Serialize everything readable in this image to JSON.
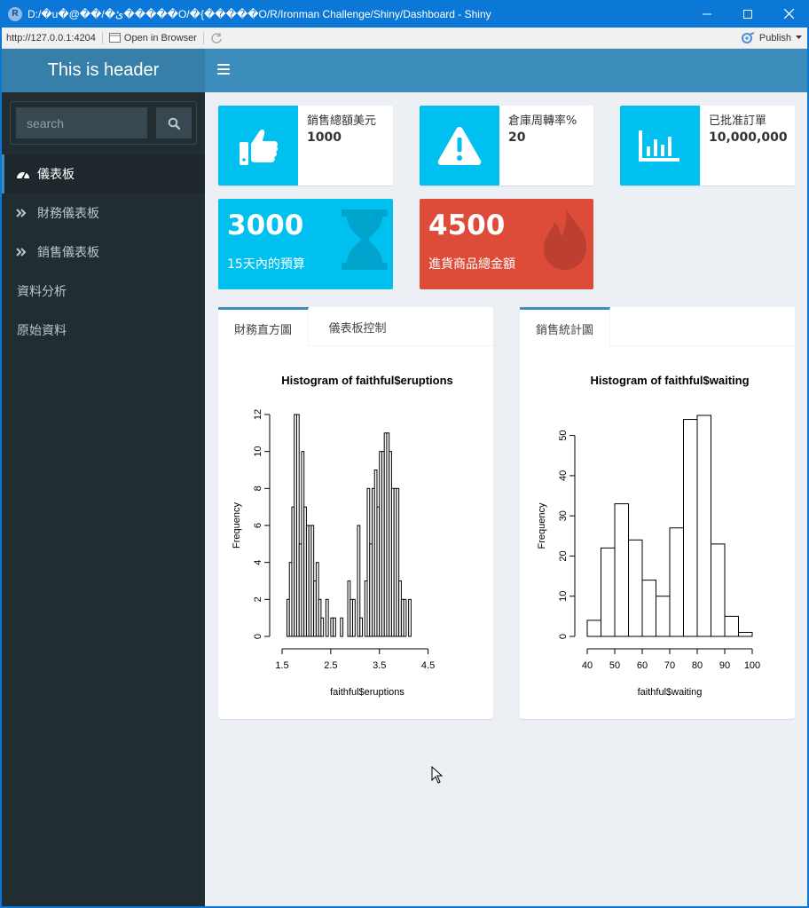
{
  "window": {
    "title": "D:/�u�@��/�ئ�����O/�{�����O/R/Ironman Challenge/Shiny/Dashboard - Shiny",
    "app_icon_letter": "R"
  },
  "toolbar": {
    "url": "http://127.0.0.1:4204",
    "open_in_browser": "Open in Browser",
    "publish": "Publish"
  },
  "header": {
    "title": "This is header"
  },
  "sidebar": {
    "search_placeholder": "search",
    "items": [
      {
        "label": "儀表板",
        "icon": "dashboard-icon",
        "active": true
      },
      {
        "label": "財務儀表板",
        "icon": "angle-double-right-icon"
      },
      {
        "label": "銷售儀表板",
        "icon": "angle-double-right-icon"
      },
      {
        "label": "資料分析"
      },
      {
        "label": "原始資料"
      }
    ]
  },
  "info_boxes": [
    {
      "label": "銷售總額美元",
      "value": "1000",
      "icon": "thumbs-up-icon"
    },
    {
      "label": "倉庫周轉率%",
      "value": "20",
      "icon": "warning-icon"
    },
    {
      "label": "已批准訂單",
      "value": "10,000,000",
      "icon": "bar-chart-icon"
    }
  ],
  "value_boxes": [
    {
      "value": "3000",
      "label": "15天內的預算",
      "icon": "hourglass-icon",
      "color": "#00c0ef"
    },
    {
      "value": "4500",
      "label": "進貨商品總金額",
      "icon": "fire-icon",
      "color": "#dd4b39"
    }
  ],
  "colors": {
    "accent": "#3c8dbc",
    "aqua": "#00c0ef",
    "red": "#dd4b39",
    "sidebar": "#222d32",
    "content_bg": "#ecf0f5"
  },
  "tabbox_left": {
    "tabs": [
      "財務直方圖",
      "儀表板控制"
    ],
    "active": 0
  },
  "tabbox_right": {
    "tabs": [
      "銷售統計圖"
    ],
    "active": 0
  },
  "chart_data": [
    {
      "type": "bar",
      "title": "Histogram of faithful$eruptions",
      "xlabel": "faithful$eruptions",
      "ylabel": "Frequency",
      "bin_width": 0.05,
      "x_start": 1.6,
      "values": [
        2,
        4,
        7,
        12,
        12,
        5,
        10,
        7,
        6,
        6,
        6,
        3,
        4,
        2,
        1,
        0,
        2,
        0,
        1,
        1,
        0,
        0,
        1,
        0,
        0,
        3,
        2,
        2,
        0,
        6,
        1,
        0,
        3,
        8,
        5,
        8,
        9,
        7,
        10,
        10,
        11,
        11,
        10,
        8,
        8,
        8,
        3,
        2,
        2,
        0,
        2
      ],
      "xticks": [
        "1.5",
        "2.5",
        "3.5",
        "4.5"
      ],
      "yticks": [
        "0",
        "2",
        "4",
        "6",
        "8",
        "10",
        "12"
      ],
      "xlim": [
        1.5,
        5.0
      ],
      "ylim": [
        0,
        12
      ]
    },
    {
      "type": "bar",
      "title": "Histogram of faithful$waiting",
      "xlabel": "faithful$waiting",
      "ylabel": "Frequency",
      "bin_width": 5,
      "x_start": 40,
      "values": [
        4,
        22,
        33,
        24,
        14,
        10,
        27,
        54,
        55,
        23,
        5,
        1
      ],
      "xticks": [
        "40",
        "50",
        "60",
        "70",
        "80",
        "90",
        "100"
      ],
      "yticks": [
        "0",
        "10",
        "20",
        "30",
        "40",
        "50"
      ],
      "xlim": [
        40,
        100
      ],
      "ylim": [
        0,
        55
      ]
    }
  ]
}
